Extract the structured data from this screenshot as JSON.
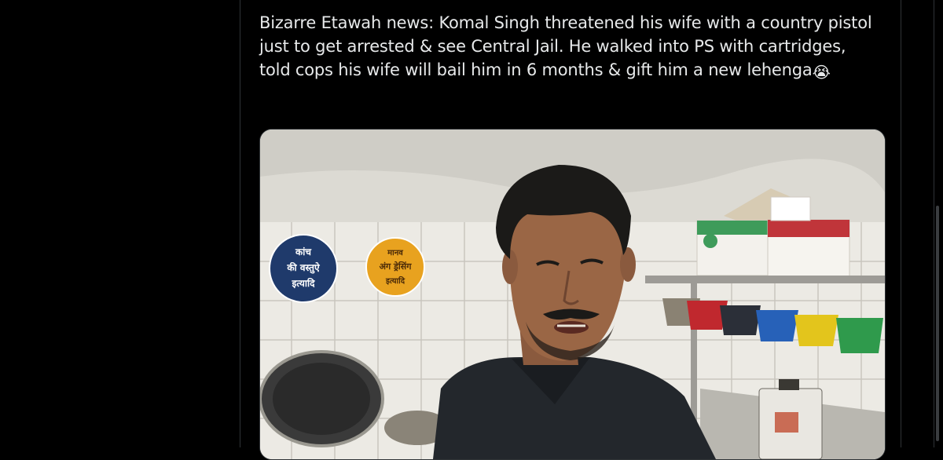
{
  "tweet": {
    "text": "Bizarre Etawah news: Komal Singh threatened his wife with a country pistol just to get arrested & see Central Jail. He walked into PS with cartridges, told cops his wife will bail him in 6 months & gift him a new lehenga",
    "emoji": "😭"
  },
  "media": {
    "sign_blue": [
      "कांच",
      "की वस्तुऐ",
      "इत्यादि"
    ],
    "sign_orange": [
      "मानव",
      "अंग ड्रेसिंग",
      "इत्यादि"
    ],
    "colors": {
      "sign_blue": "#1f3a6b",
      "sign_orange": "#e8a21f"
    }
  }
}
